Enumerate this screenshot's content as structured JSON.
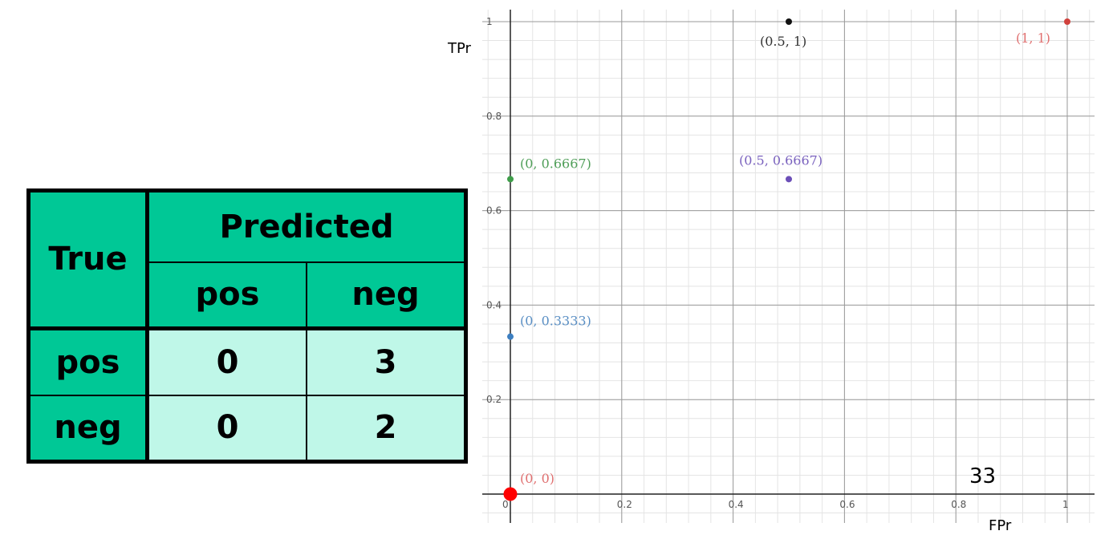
{
  "table": {
    "header_true": "True",
    "header_predicted": "Predicted",
    "col_pos": "pos",
    "col_neg": "neg",
    "rows": [
      {
        "label": "pos",
        "pred_pos": "0",
        "pred_neg": "3"
      },
      {
        "label": "neg",
        "pred_pos": "0",
        "pred_neg": "2"
      }
    ],
    "colors": {
      "header": "#00c896",
      "cells": "#bff7e8"
    }
  },
  "chart_data": {
    "type": "scatter",
    "xlabel": "FPr",
    "ylabel": "TPr",
    "xlim": [
      0,
      1
    ],
    "ylim": [
      0,
      1
    ],
    "x_ticks": [
      "0",
      "0.2",
      "0.4",
      "0.6",
      "0.8",
      "1"
    ],
    "y_ticks": [
      "0.2",
      "0.4",
      "0.6",
      "0.8",
      "1"
    ],
    "grid": true,
    "points": [
      {
        "x": 0,
        "y": 0,
        "label": "(0, 0)",
        "color": "#ff0000",
        "label_color": "#e07070"
      },
      {
        "x": 0,
        "y": 0.3333,
        "label": "(0, 0.3333)",
        "color": "#3d7fc1",
        "label_color": "#5a8fc4"
      },
      {
        "x": 0,
        "y": 0.6667,
        "label": "(0, 0.6667)",
        "color": "#3f9e4a",
        "label_color": "#4f9e58"
      },
      {
        "x": 0.5,
        "y": 0.6667,
        "label": "(0.5, 0.6667)",
        "color": "#6c4fb8",
        "label_color": "#7a62be"
      },
      {
        "x": 0.5,
        "y": 1,
        "label": "(0.5, 1)",
        "color": "#111111",
        "label_color": "#333333"
      },
      {
        "x": 1,
        "y": 1,
        "label": "(1, 1)",
        "color": "#d0413c",
        "label_color": "#e07070"
      }
    ]
  },
  "page_number": "33"
}
